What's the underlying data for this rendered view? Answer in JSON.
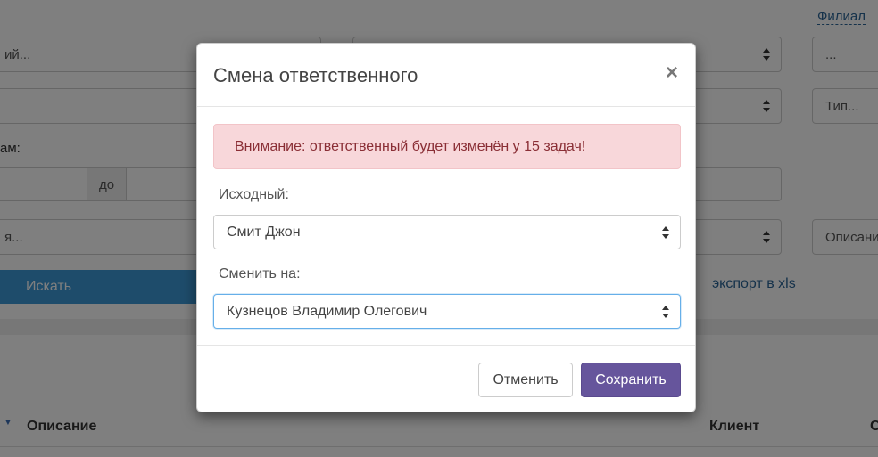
{
  "background": {
    "filial_link": "Филиал",
    "field_1": "ий...",
    "field_type": "Тип...",
    "field_dots": "...",
    "label_by_dates": "ам:",
    "addon_to": "до",
    "field_4": "я...",
    "field_description": "Описани",
    "search_button": "Искать",
    "export_link": "экспорт в xls",
    "table": {
      "headers": {
        "description": "Описание",
        "client": "Клиент",
        "last": "С"
      }
    }
  },
  "modal": {
    "title": "Смена ответственного",
    "close_symbol": "×",
    "alert": "Внимание: ответственный будет изменён у 15 задач!",
    "source_label": "Исходный:",
    "source_value": "Смит Джон",
    "target_label": "Сменить на:",
    "target_value": "Кузнецов Владимир Олегович",
    "cancel_label": "Отменить",
    "save_label": "Сохранить"
  },
  "colors": {
    "primary": "#66559c",
    "alert_bg": "#f8d7da",
    "alert_text": "#8a2e35",
    "search_button": "#3c98d6",
    "link": "#2a6496"
  }
}
